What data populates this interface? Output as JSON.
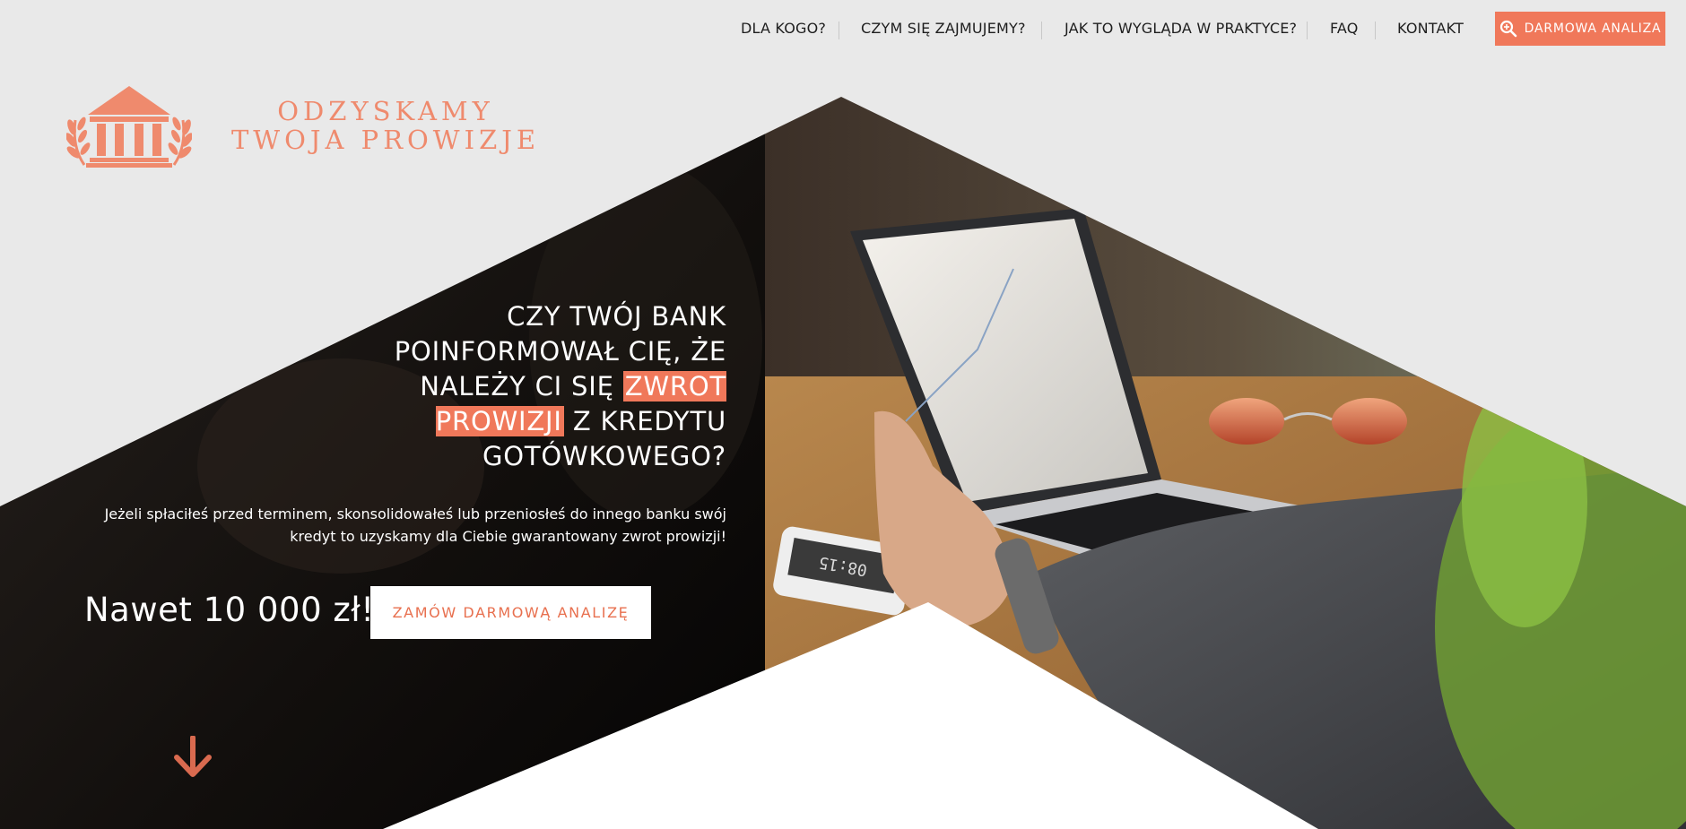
{
  "nav": {
    "items": [
      {
        "label": "DLA KOGO?"
      },
      {
        "label": "CZYM SIĘ ZAJMUJEMY?"
      },
      {
        "label": "JAK TO WYGLĄDA W PRAKTYCE?"
      },
      {
        "label": "FAQ"
      },
      {
        "label": "KONTAKT"
      }
    ],
    "cta_label": "DARMOWA ANALIZA",
    "cta_icon": "search-icon"
  },
  "logo": {
    "line1": "ODZYSKAMY",
    "line2": "TWOJA PROWIZJE",
    "icon": "bank-building-icon"
  },
  "hero": {
    "headline_part1": "CZY TWÓJ BANK POINFORMOWAŁ CIĘ, ŻE NALEŻY CI SIĘ",
    "headline_highlight": "ZWROT PROWIZJI",
    "headline_part2": "Z KREDYTU GOTÓWKOWEGO?",
    "subtext": "Jeżeli spłaciłeś przed terminem, skonsolidowałeś lub przeniosłeś do innego banku swój kredyt to uzyskamy dla Ciebie gwarantowany zwrot prowizji!",
    "amount": "Nawet 10 000 zł!",
    "cta_label": "ZAMÓW DARMOWĄ ANALIZĘ",
    "scroll_icon": "arrow-down-icon",
    "phone_display": "08:15"
  },
  "colors": {
    "accent": "#f0785a",
    "background": "#e9e9e9",
    "dark": "#141110"
  }
}
